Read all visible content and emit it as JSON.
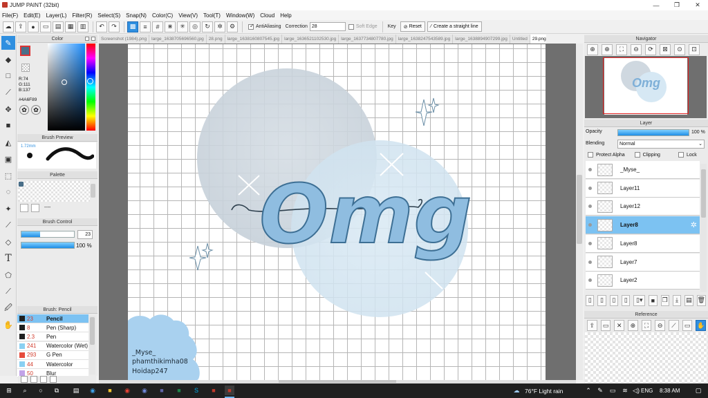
{
  "app": {
    "title": "JUMP PAINT (32bit)"
  },
  "menu": [
    "File(F)",
    "Edit(E)",
    "Layer(L)",
    "Filter(R)",
    "Select(S)",
    "Snap(N)",
    "Color(C)",
    "View(V)",
    "Tool(T)",
    "Window(W)",
    "Cloud",
    "Help"
  ],
  "toolbar": {
    "antialiasing": "AntiAliasing",
    "correction_label": "Correction",
    "correction_value": "28",
    "soft_edge": "Soft Edge",
    "key": "Key",
    "reset": "Reset",
    "straight_line": "Create a straight line"
  },
  "color": {
    "title": "Color",
    "r": "R:74",
    "g": "G:111",
    "b": "B:137",
    "hex": "#4A6F89",
    "main": "#4A6F89"
  },
  "brush_preview": {
    "title": "Brush Preview",
    "size": "1.72mm"
  },
  "palette": {
    "title": "Palette",
    "dash": "----"
  },
  "brush_control": {
    "title": "Brush Control",
    "size": "23",
    "opacity": "100 %",
    "size_fill": 0.35,
    "opacity_fill": 1.0
  },
  "brush_list": {
    "title": "Brush: Pencil",
    "items": [
      {
        "n": "23",
        "t": "Pencil",
        "c": "#1f1f1f"
      },
      {
        "n": "8",
        "t": "Pen (Sharp)",
        "c": "#1f1f1f"
      },
      {
        "n": "2.3",
        "t": "Pen",
        "c": "#1f1f1f"
      },
      {
        "n": "241",
        "t": "Watercolor (Wet)",
        "c": "#8ad0f2"
      },
      {
        "n": "293",
        "t": "G Pen",
        "c": "#e64b3c"
      },
      {
        "n": "44",
        "t": "Watercolor",
        "c": "#8ad0f2"
      },
      {
        "n": "50",
        "t": "Blur",
        "c": "#c2a3e8"
      }
    ]
  },
  "tabs": [
    "Screenshot (1984).png",
    "large_1638705696560.jpg",
    "28.png",
    "large_1638160807545.jpg",
    "large_1636521102530.jpg",
    "large_1637734807780.jpg",
    "large_1638247543589.jpg",
    "large_1638894907299.jpg",
    "Untitled",
    "29.png"
  ],
  "artwork": {
    "word": "Omg",
    "signature": [
      "_Myse_",
      "phamthikimha08",
      "Hoidap247"
    ]
  },
  "navigator": {
    "title": "Navigator"
  },
  "layer": {
    "title": "Layer",
    "opacity_label": "Opacity",
    "opacity_value": "100 %",
    "blending_label": "Blending",
    "blending_value": "Normal",
    "protect_alpha": "Protect Alpha",
    "clipping": "Clipping",
    "lock": "Lock",
    "items": [
      "_Myse_",
      "Layer11",
      "Layer12",
      "Layer8",
      "Layer8",
      "Layer7",
      "Layer2"
    ],
    "selected": 3
  },
  "reference": {
    "title": "Reference"
  },
  "taskbar": {
    "weather": "76°F  Light rain",
    "lang": "ENG",
    "time": "8:38 AM"
  }
}
